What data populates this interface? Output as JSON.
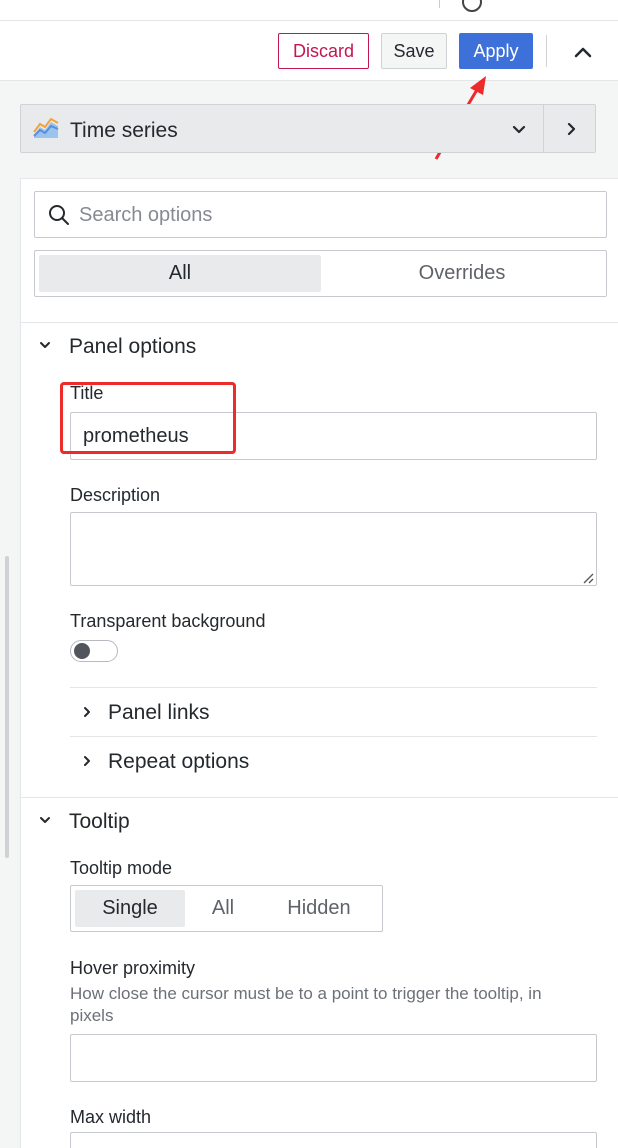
{
  "toolbar": {
    "discard_label": "Discard",
    "save_label": "Save",
    "apply_label": "Apply"
  },
  "visualization": {
    "name": "Time series",
    "icon": "time-series-chart-icon"
  },
  "options_pane": {
    "search": {
      "placeholder": "Search options",
      "value": ""
    },
    "tabs": [
      {
        "label": "All",
        "active": true
      },
      {
        "label": "Overrides",
        "active": false
      }
    ]
  },
  "panel_options": {
    "section_label": "Panel options",
    "title_label": "Title",
    "title_value": "prometheus",
    "description_label": "Description",
    "description_value": "",
    "transparent_label": "Transparent background",
    "transparent_value": false,
    "panel_links_label": "Panel links",
    "repeat_options_label": "Repeat options"
  },
  "tooltip": {
    "section_label": "Tooltip",
    "mode_label": "Tooltip mode",
    "modes": [
      {
        "label": "Single",
        "active": true
      },
      {
        "label": "All",
        "active": false
      },
      {
        "label": "Hidden",
        "active": false
      }
    ],
    "hover_label": "Hover proximity",
    "hover_desc": "How close the cursor must be to a point to trigger the tooltip, in pixels",
    "hover_value": "",
    "max_width_label": "Max width",
    "max_width_value": ""
  },
  "colors": {
    "discard": "#c4164f",
    "apply": "#3d71d9",
    "annotation": "#ee2b2b"
  }
}
